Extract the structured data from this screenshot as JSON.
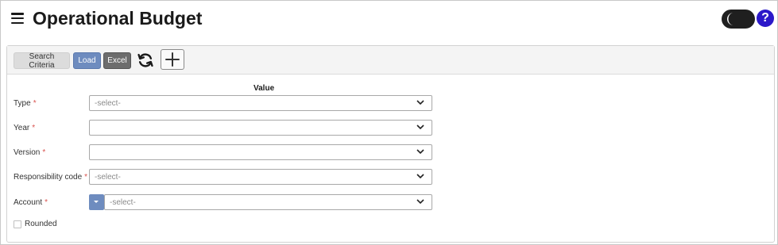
{
  "header": {
    "title": "Operational Budget",
    "help_label": "?"
  },
  "toolbar": {
    "search_criteria_label": "Search Criteria",
    "load_label": "Load",
    "excel_label": "Excel"
  },
  "form": {
    "column_header": "Value",
    "required_marker": "*",
    "fields": [
      {
        "label": "Type",
        "placeholder": "-select-",
        "required": true
      },
      {
        "label": "Year",
        "placeholder": "",
        "required": true
      },
      {
        "label": "Version",
        "placeholder": "",
        "required": true
      },
      {
        "label": "Responsibility code",
        "placeholder": "-select-",
        "required": true
      },
      {
        "label": "Account",
        "placeholder": "-select-",
        "required": true
      }
    ],
    "rounded_label": "Rounded",
    "rounded_checked": false
  },
  "colors": {
    "load_button": "#6e8cbf",
    "excel_button": "#6d6d6d",
    "help_icon": "#2b18c9",
    "required": "#d9534f"
  },
  "icons": [
    "menu-icon",
    "moon-icon",
    "help-icon",
    "refresh-icon",
    "plus-icon",
    "chevron-down-icon"
  ]
}
